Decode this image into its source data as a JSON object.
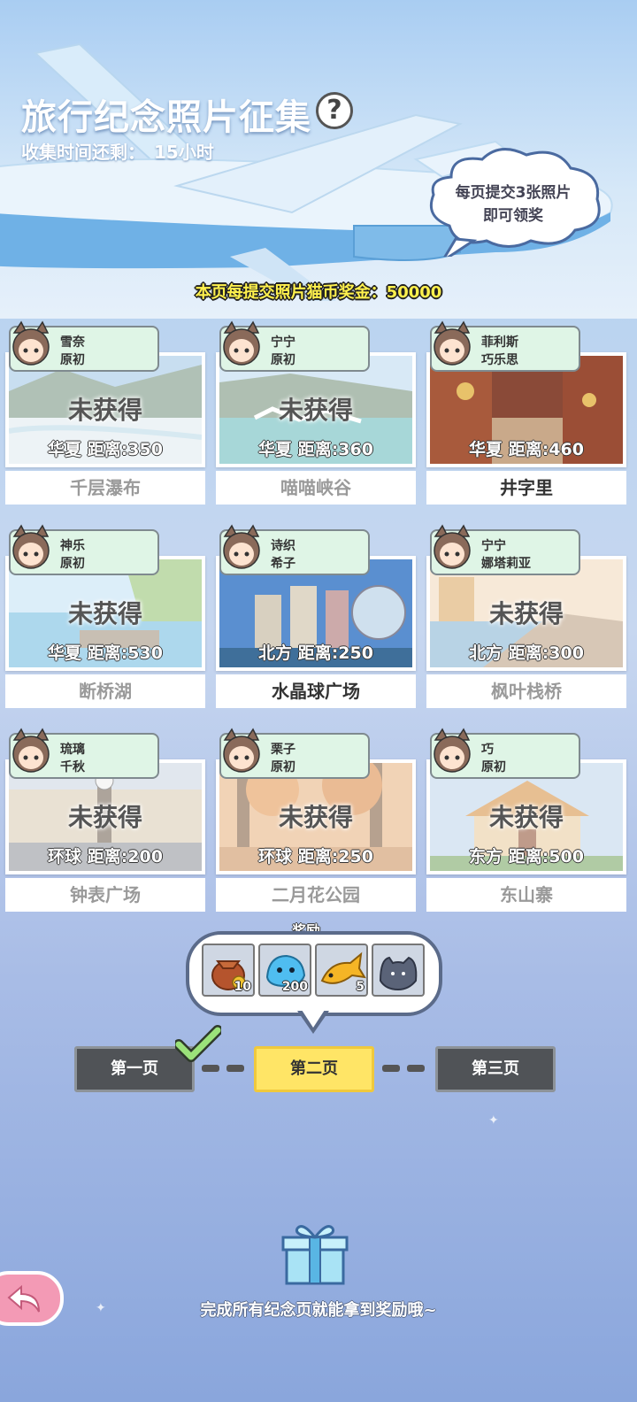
{
  "header": {
    "title": "旅行纪念照片征集",
    "help_icon": "?",
    "timer_label": "收集时间还剩：",
    "timer_value": "15小时",
    "tip": [
      "每页提交3张照片",
      "即可领奖"
    ],
    "bonus": "本页每提交照片猫币奖金：50000"
  },
  "status_text": "未获得",
  "cards": [
    {
      "char1": "雪奈",
      "char2": "原初",
      "region": "华夏",
      "distance": "距离:350",
      "name": "千层瀑布",
      "got": false,
      "scene": "waterfall"
    },
    {
      "char1": "宁宁",
      "char2": "原初",
      "region": "华夏",
      "distance": "距离:360",
      "name": "喵喵峡谷",
      "got": false,
      "scene": "canyon"
    },
    {
      "char1": "菲利斯",
      "char2": "巧乐思",
      "region": "华夏",
      "distance": "距离:460",
      "name": "井字里",
      "got": true,
      "scene": "street"
    },
    {
      "char1": "神乐",
      "char2": "原初",
      "region": "华夏",
      "distance": "距离:530",
      "name": "断桥湖",
      "got": false,
      "scene": "lake"
    },
    {
      "char1": "诗织",
      "char2": "希子",
      "region": "北方",
      "distance": "距离:250",
      "name": "水晶球广场",
      "got": true,
      "scene": "city"
    },
    {
      "char1": "宁宁",
      "char2": "娜塔莉亚",
      "region": "北方",
      "distance": "距离:300",
      "name": "枫叶栈桥",
      "got": false,
      "scene": "bridge"
    },
    {
      "char1": "琉璃",
      "char2": "千秋",
      "region": "环球",
      "distance": "距离:200",
      "name": "钟表广场",
      "got": false,
      "scene": "square"
    },
    {
      "char1": "栗子",
      "char2": "原初",
      "region": "环球",
      "distance": "距离:250",
      "name": "二月花公园",
      "got": false,
      "scene": "park"
    },
    {
      "char1": "巧",
      "char2": "原初",
      "region": "东方",
      "distance": "距离:500",
      "name": "东山寨",
      "got": false,
      "scene": "temple"
    }
  ],
  "reward": {
    "label": "奖励",
    "items": [
      {
        "icon": "coin-bag-icon",
        "count": "10"
      },
      {
        "icon": "blue-slime-icon",
        "count": "200"
      },
      {
        "icon": "fish-icon",
        "count": "5"
      },
      {
        "icon": "cat-plush-icon",
        "count": ""
      }
    ]
  },
  "pages": [
    "第一页",
    "第二页",
    "第三页"
  ],
  "footer": "完成所有纪念页就能拿到奖励哦~",
  "colors": {
    "accent": "#ffe566",
    "tag_bg": "#dff5e6",
    "back_button": "#f39ab5",
    "page_dark": "#505357"
  }
}
